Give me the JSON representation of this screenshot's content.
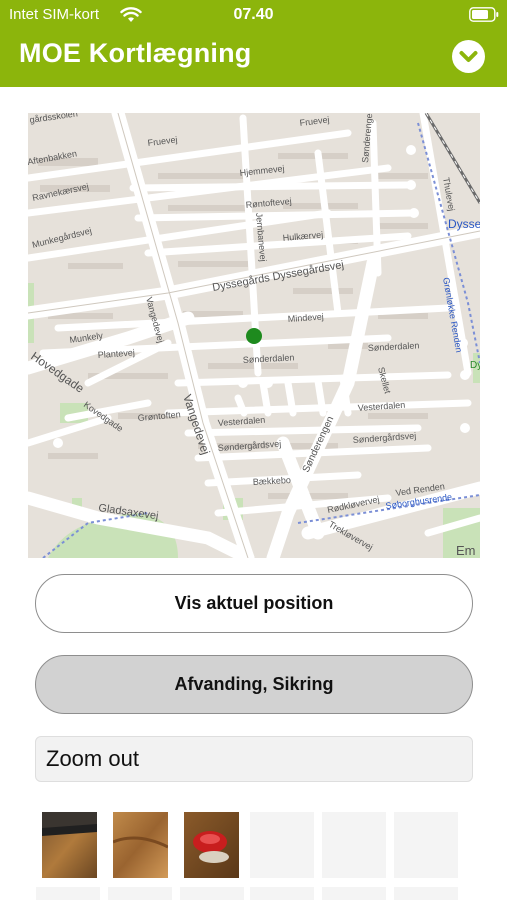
{
  "status_bar": {
    "carrier": "Intet SIM-kort",
    "time": "07.40",
    "wifi_icon": "wifi-icon",
    "battery_icon": "battery-icon"
  },
  "header": {
    "title": "MOE Kortlægning",
    "menu_icon": "chevron-down-icon",
    "background_color": "#8cb50c"
  },
  "map": {
    "location_marker_color": "#1e8a1e",
    "labels": {
      "gardsskolen": "gårdsskolen",
      "fruevej_1": "Fruevej",
      "fruevej_2": "Fruevej",
      "aftenbakken": "Aftenbakken",
      "sonderengen_top": "Sønderengen",
      "ravnekaersvej": "Ravnekærsvej",
      "hjemmevej": "Hjemmevej",
      "thulevej": "Thulevej",
      "rontoftevej": "Røntoftevej",
      "dysse": "Dysse",
      "munkegardsvej": "Munkegårdsvej",
      "hulkaervej": "Hulkærvej",
      "jernbanevej": "Jernbanevej",
      "granhoj": "Grønløkke Renden",
      "dyssegardsvej": "Dyssegårds Dyssegårdsvej",
      "vangedevej_upper": "Vangedevej",
      "mindevej": "Mindevej",
      "munkely": "Munkely",
      "plantevej": "Plantevej",
      "sonderdalen_1": "Sønderdalen",
      "sonderdalen_2": "Sønderdalen",
      "hovedgade": "Hovedgade",
      "kovedgade": "Kovedgade",
      "grontoften": "Grøntoften",
      "vesterdalen_1": "Vesterdalen",
      "vesterdalen_2": "Vesterdalen",
      "vangedevej_lower": "Vangedevej",
      "sondergardsvej_1": "Søndergårdsvej",
      "sondergardsvej_2": "Søndergårdsvej",
      "sonderengen": "Sønderengen",
      "skellet": "Skellet",
      "baekkebo": "Bækkebo",
      "gladsaxevej": "Gladsaxevej",
      "ved_renden": "Ved Renden",
      "rodklovervej": "Rødkløvervej",
      "soborghusrenden": "Søborghusrende",
      "trekloverve": "Trekløvervej",
      "em": "Em",
      "dy": "Dy"
    }
  },
  "buttons": {
    "show_position": "Vis aktuel position",
    "category": "Afvanding, Sikring"
  },
  "zoom_field": {
    "value": "Zoom out"
  }
}
